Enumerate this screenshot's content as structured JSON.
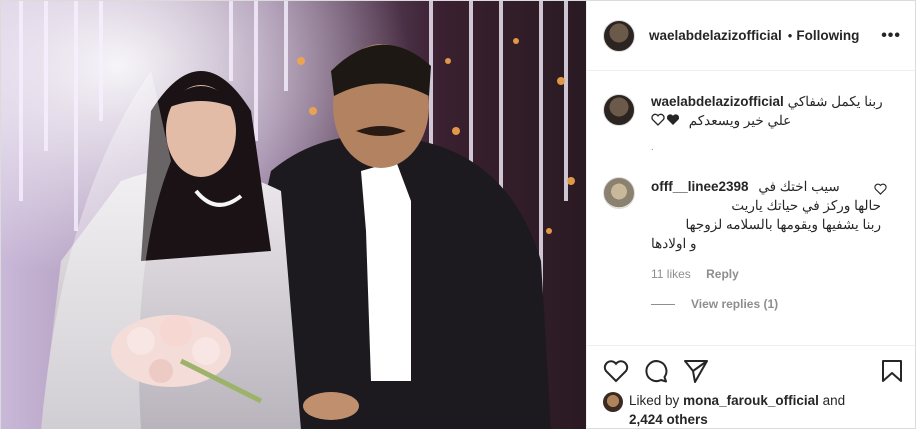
{
  "post": {
    "username": "waelabdelazizofficial",
    "dot": "•",
    "follow_status": "Following",
    "more_icon": "more-horizontal-icon",
    "caption": {
      "username": "waelabdelazizofficial",
      "line1": "ربنا يكمل شفاكي",
      "line2": "علي خير ويسعدكم",
      "dot": "."
    },
    "comment": {
      "username": "offf__linee2398",
      "text_line1": "سيب اختك في",
      "text_line2": "حالها وركز في حياتك ياريت",
      "text_line3": "ربنا يشفيها ويقومها بالسلامه لزوجها",
      "text_line4": "و اولادها",
      "likes": "11 likes",
      "reply": "Reply",
      "view_replies": "View replies (1)"
    },
    "actions": {
      "like_icon": "heart-icon",
      "comment_icon": "comment-icon",
      "share_icon": "share-icon",
      "save_icon": "bookmark-icon"
    },
    "liked_by": {
      "prefix": "Liked by",
      "user": "mona_farouk_official",
      "and": "and",
      "others": "2,424 others"
    }
  }
}
